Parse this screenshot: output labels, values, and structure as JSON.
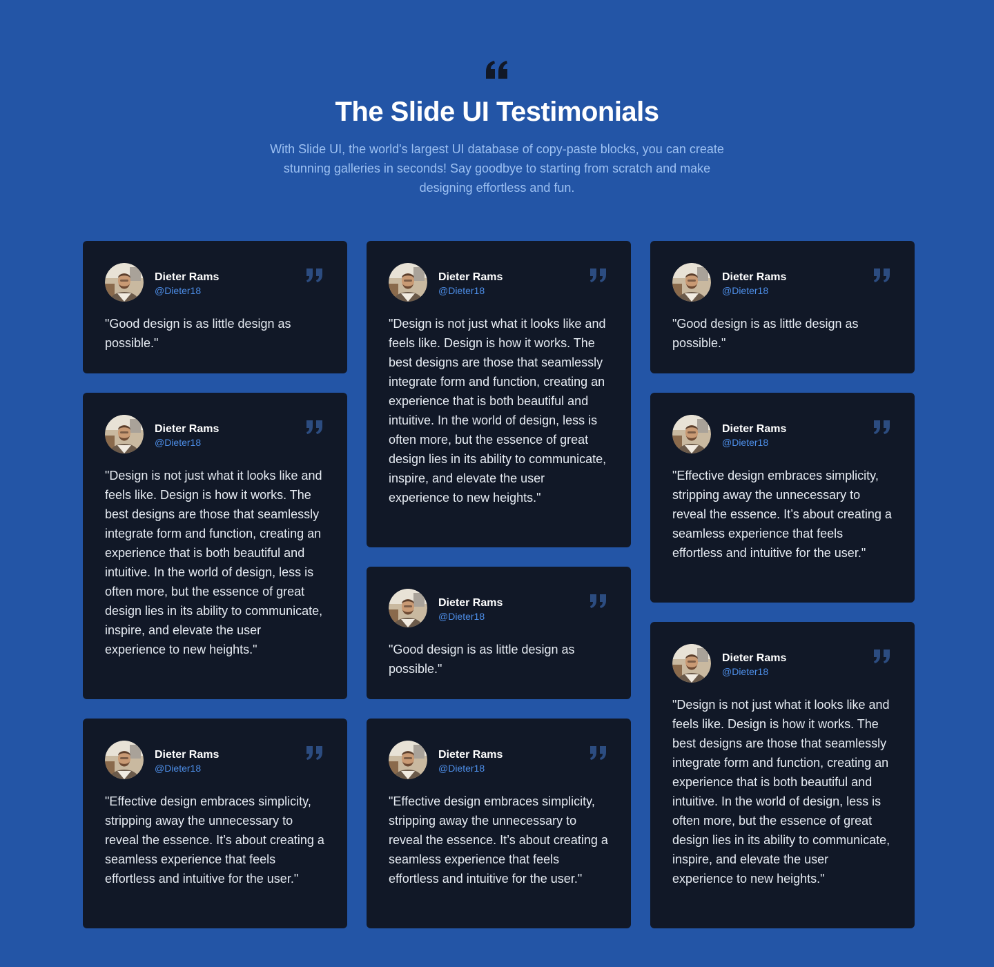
{
  "header": {
    "icon": "quote-open-icon",
    "title": "The Slide UI Testimonials",
    "subtitle": "With Slide UI, the world's largest UI database of copy-paste blocks, you can create stunning galleries in seconds! Say goodbye to starting from scratch and make designing effortless and fun."
  },
  "colors": {
    "background": "#2355a6",
    "card": "#111827",
    "handle": "#4d8ee8",
    "subtitle": "#9cc0f2",
    "quote_icon": "#2c4c80"
  },
  "columns": [
    {
      "cards": [
        {
          "name": "Dieter Rams",
          "handle": "@Dieter18",
          "text": "\"Good design is as little design as possible.\""
        },
        {
          "name": "Dieter Rams",
          "handle": "@Dieter18",
          "text": "\"Design is not just what it looks like and feels like. Design is how it works. The best designs are those that seamlessly integrate form and function, creating an experience that is both beautiful and intuitive. In the world of design, less is often more, but the essence of great design lies in its ability to communicate, inspire, and elevate the user experience to new heights.\""
        },
        {
          "name": "Dieter Rams",
          "handle": "@Dieter18",
          "text": "\"Effective design embraces simplicity, stripping away the unnecessary to reveal the essence. It’s about creating a seamless experience that feels effortless and intuitive for the user.\""
        }
      ]
    },
    {
      "cards": [
        {
          "name": "Dieter Rams",
          "handle": "@Dieter18",
          "text": "\"Design is not just what it looks like and feels like. Design is how it works. The best designs are those that seamlessly integrate form and function, creating an experience that is both beautiful and intuitive. In the world of design, less is often more, but the essence of great design lies in its ability to communicate, inspire, and elevate the user experience to new heights.\""
        },
        {
          "name": "Dieter Rams",
          "handle": "@Dieter18",
          "text": "\"Good design is as little design as possible.\""
        },
        {
          "name": "Dieter Rams",
          "handle": "@Dieter18",
          "text": "\"Effective design embraces simplicity, stripping away the unnecessary to reveal the essence. It’s about creating a seamless experience that feels effortless and intuitive for the user.\""
        }
      ]
    },
    {
      "cards": [
        {
          "name": "Dieter Rams",
          "handle": "@Dieter18",
          "text": "\"Good design is as little design as possible.\""
        },
        {
          "name": "Dieter Rams",
          "handle": "@Dieter18",
          "text": "\"Effective design embraces simplicity, stripping away the unnecessary to reveal the essence. It’s about creating a seamless experience that feels effortless and intuitive for the user.\""
        },
        {
          "name": "Dieter Rams",
          "handle": "@Dieter18",
          "text": "\"Design is not just what it looks like and feels like. Design is how it works. The best designs are those that seamlessly integrate form and function, creating an experience that is both beautiful and intuitive. In the world of design, less is often more, but the essence of great design lies in its ability to communicate, inspire, and elevate the user experience to new heights.\""
        }
      ]
    }
  ]
}
